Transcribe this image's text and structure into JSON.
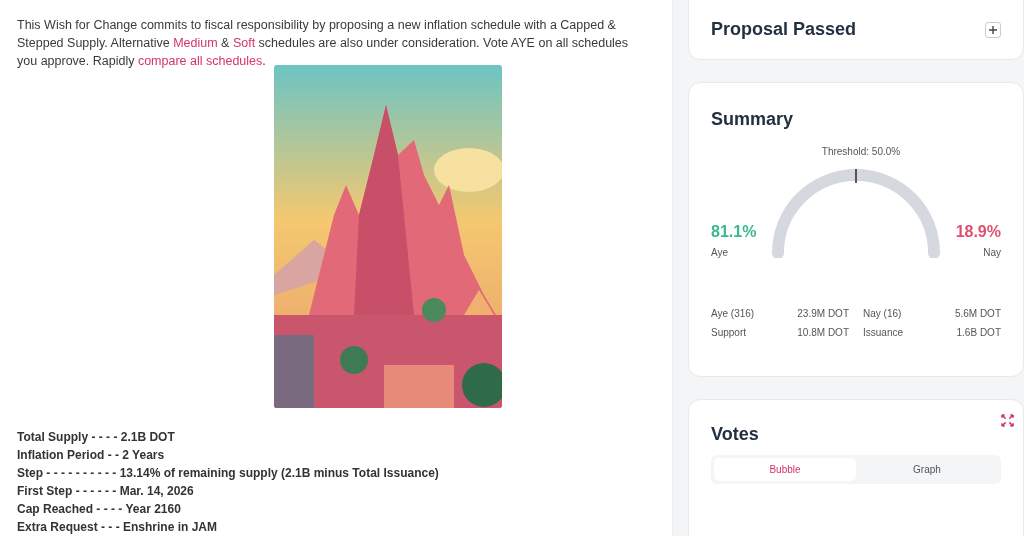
{
  "description": [
    {
      "kind": "text",
      "text": "This Wish for Change commits to fiscal responsibility by proposing a new inflation schedule with a Capped & Stepped Supply. Alternative "
    },
    {
      "kind": "link",
      "text": "Medium"
    },
    {
      "kind": "text",
      "text": " & "
    },
    {
      "kind": "link",
      "text": "Soft"
    },
    {
      "kind": "text",
      "text": " schedules are also under consideration. Vote AYE on all schedules you approve. Rapidly "
    },
    {
      "kind": "link",
      "text": "compare all schedules"
    },
    {
      "kind": "text",
      "text": "."
    }
  ],
  "illustration": {
    "kind": "picture"
  },
  "details": [
    "Total Supply - - - - 2.1B DOT",
    "Inflation Period - - 2 Years",
    "Step - - - - - - - - - - 13.14% of remaining supply (2.1B minus Total Issuance)",
    "First Step - - - - - - Mar. 14, 2026",
    "Cap Reached - - - - Year 2160",
    "Extra Request - - - Enshrine in JAM"
  ],
  "status_card": {
    "title": "Proposal Passed",
    "expanded": false
  },
  "summary": {
    "title": "Summary",
    "threshold": "Threshold: 50.0%",
    "aye_percent": "81.1%",
    "aye_label": "Aye",
    "nay_percent": "18.9%",
    "nay_label": "Nay",
    "stats": [
      {
        "label": "Aye (316)",
        "value": "23.9M DOT"
      },
      {
        "label": "Nay (16)",
        "value": "5.6M DOT"
      },
      {
        "label": "Support",
        "value": "10.8M DOT"
      },
      {
        "label": "Issuance",
        "value": "1.6B DOT"
      }
    ]
  },
  "votes": {
    "title": "Votes",
    "tabs": [
      {
        "label": "Bubble",
        "selected": true
      },
      {
        "label": "Graph",
        "selected": false
      }
    ]
  }
}
